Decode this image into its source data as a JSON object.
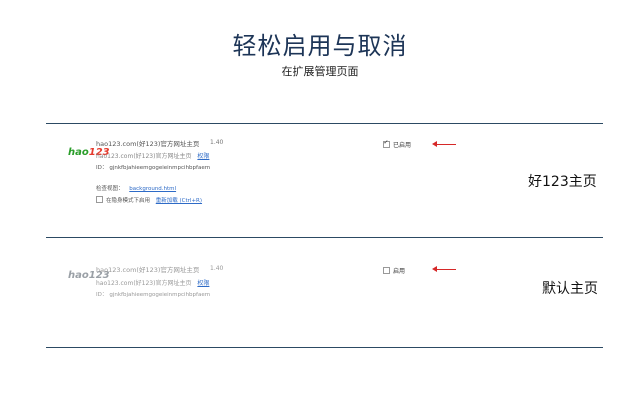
{
  "header": {
    "title": "轻松启用与取消",
    "subtitle": "在扩展管理页面"
  },
  "extensions": [
    {
      "logo": {
        "h": "hao",
        "n": "123"
      },
      "name": "hao123.com(好123)官方网址主页",
      "version": "1.40",
      "description": "hao123.com(好123)官方网址主页",
      "permissions_link": "权限",
      "id_label": "ID：",
      "id": "gjnkfbjahieemgogeieinmpcihbpfaem",
      "inspect_label": "检查视图：",
      "inspect_link": "background.html",
      "incognito_label": "在隐身模式下启用",
      "reload_link": "重新加载 (Ctrl+R)",
      "enabled_label": "已启用",
      "enabled": true,
      "callout": "好123主页"
    },
    {
      "logo": {
        "h": "hao",
        "n": "123"
      },
      "name": "hao123.com(好123)官方网址主页",
      "version": "1.40",
      "description": "hao123.com(好123)官方网址主页",
      "permissions_link": "权限",
      "id_label": "ID：",
      "id": "gjnkfbjahieemgogeieinmpcihbpfaem",
      "enabled_label": "启用",
      "enabled": false,
      "callout": "默认主页"
    }
  ],
  "colors": {
    "title": "#1d3557",
    "arrow": "#d62828",
    "link": "#2e6bc7",
    "logo_green": "#2a9d2a",
    "logo_red": "#e63b2e"
  },
  "icons": {
    "arrow": "left-arrow-icon",
    "checkbox": "checkbox-icon"
  }
}
